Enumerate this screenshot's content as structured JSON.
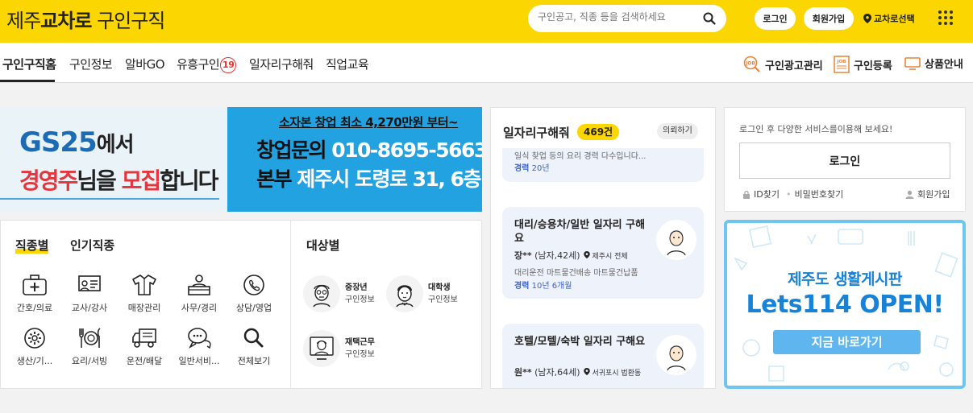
{
  "header": {
    "logo_prefix": "제주",
    "logo_bold": "교차로",
    "logo_suffix": "구인구직",
    "search_placeholder": "구인공고, 직종 등을 검색하세요",
    "login_label": "로그인",
    "signup_label": "회원가입",
    "region_label": "교차로선택",
    "brand_color": "#fcd600"
  },
  "nav": {
    "tabs": [
      "구인구직홈",
      "구인정보",
      "알바GO",
      "유흥구인",
      "일자리구해줘",
      "직업교육"
    ],
    "adult_badge": "19",
    "right_links": [
      "구인광고관리",
      "구인등록",
      "상품안내"
    ]
  },
  "banner": {
    "gs_brand": "GS25",
    "gs_suffix": "에서",
    "gs_line2_a": "경영주",
    "gs_line2_b": "님을 ",
    "gs_line2_c": "모집",
    "gs_line2_d": "합니다",
    "headline": "소자본 창업 최소 4,270만원 부터~",
    "phone_label": "창업문의",
    "phone": "010-8695-5663",
    "hq_label": "본부",
    "hq_address": "제주시 도령로 31, 6층"
  },
  "categories": {
    "tabs": [
      "직종별",
      "인기직종"
    ],
    "items": [
      {
        "label": "간호/의료",
        "icon": "medical-kit-icon"
      },
      {
        "label": "교사/강사",
        "icon": "teacher-board-icon"
      },
      {
        "label": "매장관리",
        "icon": "shirt-icon"
      },
      {
        "label": "사무/경리",
        "icon": "office-desk-icon"
      },
      {
        "label": "상담/영업",
        "icon": "phone-icon"
      },
      {
        "label": "생산/기...",
        "icon": "gear-icon"
      },
      {
        "label": "요리/서빙",
        "icon": "cutlery-icon"
      },
      {
        "label": "운전/배달",
        "icon": "truck-icon"
      },
      {
        "label": "일반서비...",
        "icon": "chat-bubble-icon"
      },
      {
        "label": "전체보기",
        "icon": "search-icon"
      }
    ],
    "target_title": "대상별",
    "targets": [
      {
        "line1": "중장년",
        "line2": "구인정보",
        "icon": "elder-face-icon"
      },
      {
        "line1": "대학생",
        "line2": "구인정보",
        "icon": "student-face-icon"
      },
      {
        "line1": "재택근무",
        "line2": "구인정보",
        "icon": "remote-worker-icon"
      }
    ]
  },
  "jobs": {
    "title": "일자리구해줘",
    "count": "469건",
    "request_label": "의뢰하기",
    "partial_desc": "일식 찾업 등의 요리 경력 다수입니다...",
    "partial_career_label": "경력",
    "partial_career_value": "20년",
    "cards": [
      {
        "title": "대리/승용차/일반 일자리 구해요",
        "name": "장**",
        "info": "(남자,42세)",
        "location": "제주시 전체",
        "desc": "대리운전 마트물건배송 마트물건납품",
        "career_label": "경력",
        "career_value": "10년 6개월"
      },
      {
        "title": "호텔/모텔/숙박 일자리 구해요",
        "name": "원**",
        "info": "(남자,64세)",
        "location": "서귀포시 법환동"
      }
    ]
  },
  "login_box": {
    "hint": "로그인 후 다양한 서비스를이용해 보세요!",
    "login_button": "로그인",
    "find_id": "ID찾기",
    "find_pw": "비밀번호찾기",
    "signup": "회원가입"
  },
  "ad": {
    "line1": "제주도 생활게시판",
    "line2": "Lets114 OPEN!",
    "cta": "지금 바로가기",
    "accent_color": "#1782d6"
  }
}
